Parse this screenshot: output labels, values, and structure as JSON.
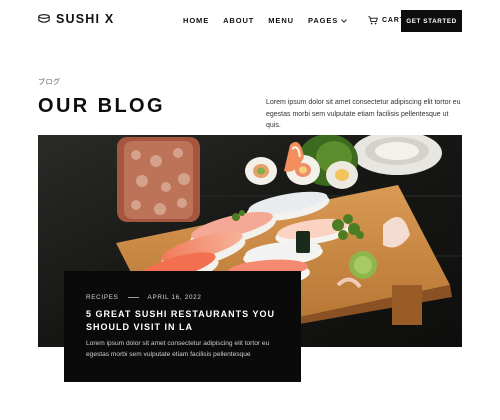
{
  "brand": {
    "name": "SUSHI X",
    "logo_icon": "sushi-bowl-icon"
  },
  "nav": {
    "items": [
      {
        "label": "HOME"
      },
      {
        "label": "ABOUT"
      },
      {
        "label": "MENU"
      },
      {
        "label": "PAGES",
        "icon": "chevron-down-icon"
      }
    ]
  },
  "header": {
    "cart_label": "CART",
    "cart_icon": "cart-icon",
    "cta_label": "GET STARTED"
  },
  "hero": {
    "eyebrow": "ブログ",
    "title": "OUR BLOG",
    "intro": "Lorem ipsum dolor sit amet consectetur adipiscing elit tortor eu egestas morbi sem vulputate etiam facilisis pellentesque ut quis."
  },
  "featured_post": {
    "category": "RECIPES",
    "date": "APRIL 16, 2022",
    "title": "5 GREAT SUSHI RESTAURANTS YOU SHOULD VISIT IN LA",
    "excerpt": "Lorem ipsum dolor sit amet consectetur adipiscing elit tortor eu egestas morbi sem vulputate etiam facilisis pellentesque"
  },
  "colors": {
    "accent": "#0d0d0d",
    "background": "#ffffff",
    "card": "#0a0a0a"
  }
}
